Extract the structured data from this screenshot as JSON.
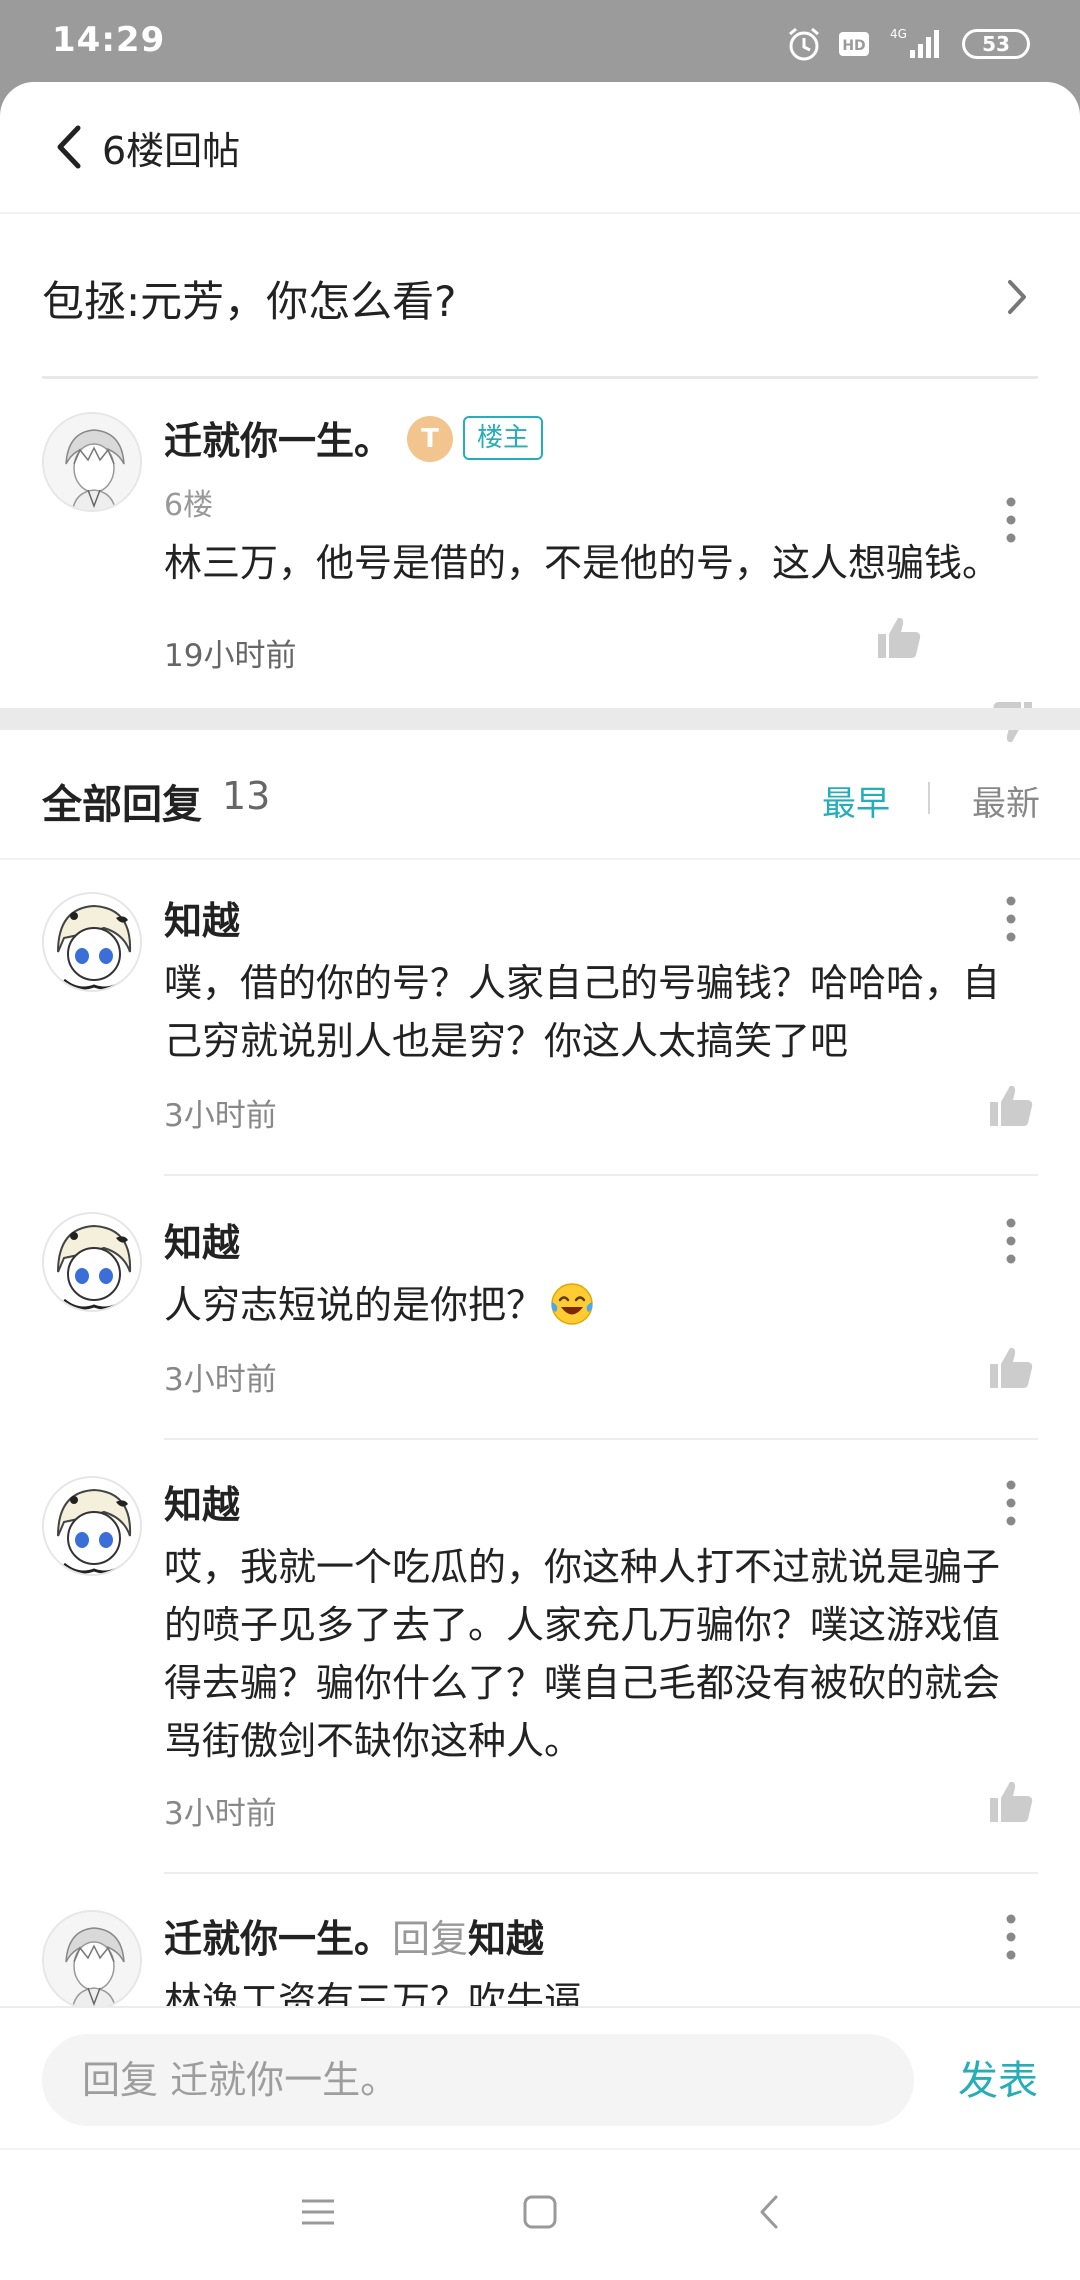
{
  "status_bar": {
    "time": "14:29",
    "battery": "53",
    "network": "4G",
    "hd": "HD"
  },
  "header": {
    "title": "6楼回帖"
  },
  "thread": {
    "title": "包拯:元芳，你怎么看?"
  },
  "post": {
    "author": "迁就你一生。",
    "coin_badge": "T",
    "host_badge": "楼主",
    "floor": "6楼",
    "content": "林三万，他号是借的，不是他的号，这人想骗钱。",
    "time": "19小时前"
  },
  "replies_header": {
    "title": "全部回复",
    "count": "13",
    "sort_earliest": "最早",
    "sort_latest": "最新"
  },
  "replies": [
    {
      "author": "知越",
      "content": "噗，借的你的号？人家自己的号骗钱？哈哈哈，自己穷就说别人也是穷？你这人太搞笑了吧",
      "time": "3小时前"
    },
    {
      "author": "知越",
      "content": "人穷志短说的是你把？",
      "time": "3小时前"
    },
    {
      "author": "知越",
      "content": "哎，我就一个吃瓜的，你这种人打不过就说是骗子的喷子见多了去了。人家充几万骗你？噗这游戏值得去骗？骗你什么了？噗自己毛都没有被砍的就会骂街傲剑不缺你这种人。",
      "time": "3小时前"
    },
    {
      "author": "迁就你一生。",
      "reply_label": "回复",
      "reply_to": "知越",
      "content": "林逸工资有三万？吹牛逼"
    }
  ],
  "compose": {
    "placeholder": "回复 迁就你一生。",
    "submit_label": "发表"
  },
  "colors": {
    "accent": "#25aeb8",
    "status_bar": "#9b9b9b",
    "coin_badge": "#f2c48e"
  }
}
